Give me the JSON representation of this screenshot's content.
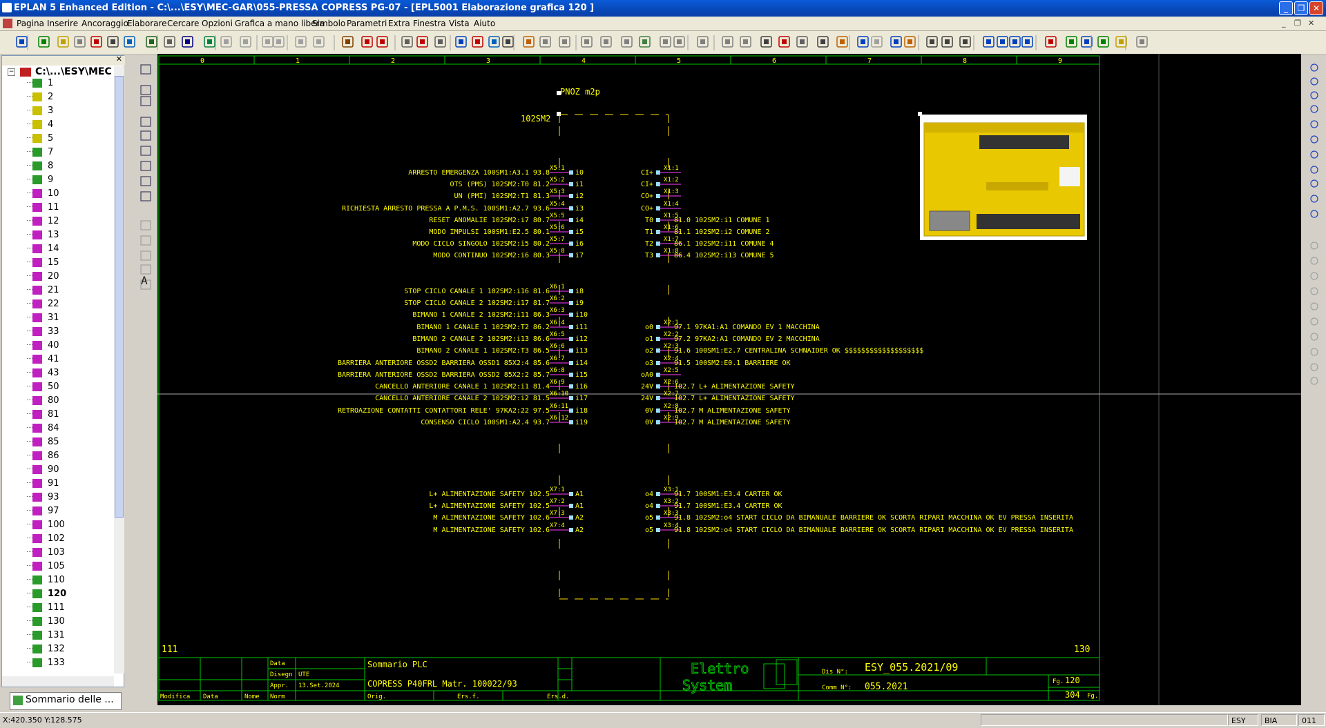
{
  "window": {
    "title": "EPLAN 5 Enhanced Edition - C:\\...\\ESY\\MEC-GAR\\055-PRESSA COPRESS PG-07 - [EPL5001 Elaborazione grafica 120    ]"
  },
  "menu": [
    "Pagina",
    "Inserire",
    "Ancoraggio",
    "Elaborare",
    "Cercare",
    "Opzioni",
    "Grafica a mano libera",
    "Simbolo",
    "Parametri",
    "Extra",
    "Finestra",
    "Vista",
    "Aiuto"
  ],
  "tree": {
    "root": "C:\\...\\ESY\\MEC",
    "pages": [
      {
        "label": "1",
        "type": "green"
      },
      {
        "label": "2",
        "type": "yellow"
      },
      {
        "label": "3",
        "type": "yellow"
      },
      {
        "label": "4",
        "type": "yellow"
      },
      {
        "label": "5",
        "type": "yellow"
      },
      {
        "label": "7",
        "type": "green"
      },
      {
        "label": "8",
        "type": "green"
      },
      {
        "label": "9",
        "type": "green"
      },
      {
        "label": "10",
        "type": "magenta"
      },
      {
        "label": "11",
        "type": "magenta"
      },
      {
        "label": "12",
        "type": "magenta"
      },
      {
        "label": "13",
        "type": "magenta"
      },
      {
        "label": "14",
        "type": "magenta"
      },
      {
        "label": "15",
        "type": "magenta"
      },
      {
        "label": "20",
        "type": "magenta"
      },
      {
        "label": "21",
        "type": "magenta"
      },
      {
        "label": "22",
        "type": "magenta"
      },
      {
        "label": "31",
        "type": "magenta"
      },
      {
        "label": "33",
        "type": "magenta"
      },
      {
        "label": "40",
        "type": "magenta"
      },
      {
        "label": "41",
        "type": "magenta"
      },
      {
        "label": "43",
        "type": "magenta"
      },
      {
        "label": "50",
        "type": "magenta"
      },
      {
        "label": "80",
        "type": "magenta"
      },
      {
        "label": "81",
        "type": "magenta"
      },
      {
        "label": "84",
        "type": "magenta"
      },
      {
        "label": "85",
        "type": "magenta"
      },
      {
        "label": "86",
        "type": "magenta"
      },
      {
        "label": "90",
        "type": "magenta"
      },
      {
        "label": "91",
        "type": "magenta"
      },
      {
        "label": "93",
        "type": "magenta"
      },
      {
        "label": "97",
        "type": "magenta"
      },
      {
        "label": "100",
        "type": "magenta"
      },
      {
        "label": "102",
        "type": "magenta"
      },
      {
        "label": "103",
        "type": "magenta"
      },
      {
        "label": "105",
        "type": "magenta"
      },
      {
        "label": "110",
        "type": "green"
      },
      {
        "label": "120",
        "type": "green",
        "selected": true
      },
      {
        "label": "111",
        "type": "green"
      },
      {
        "label": "130",
        "type": "green"
      },
      {
        "label": "131",
        "type": "green"
      },
      {
        "label": "132",
        "type": "green"
      },
      {
        "label": "133",
        "type": "green"
      }
    ],
    "tab_label": "Sommario delle ..."
  },
  "drawing": {
    "columns": [
      "0",
      "1",
      "2",
      "3",
      "4",
      "5",
      "6",
      "7",
      "8",
      "9"
    ],
    "device_name": "PNOZ m2p",
    "device_tag": "102SM2",
    "left_terminals": [
      {
        "label": "ARRESTO EMERGENZA 100SM1:A3.1 93.8",
        "term": "X5:1",
        "io": "i0"
      },
      {
        "label": "OTS (PMS) 102SM2:T0 81.2",
        "term": "X5:2",
        "io": "i1"
      },
      {
        "label": "UN (PMI) 102SM2:T1 81.3",
        "term": "X5:3",
        "io": "i2"
      },
      {
        "label": "RICHIESTA ARRESTO PRESSA A P.M.S. 100SM1:A2.7 93.6",
        "term": "X5:4",
        "io": "i3"
      },
      {
        "label": "RESET ANOMALIE 102SM2:i7 80.7",
        "term": "X5:5",
        "io": "i4"
      },
      {
        "label": "MODO IMPULSI 100SM1:E2.5 80.1",
        "term": "X5:6",
        "io": "i5"
      },
      {
        "label": "MODO CICLO SINGOLO 102SM2:i5 80.2",
        "term": "X5:7",
        "io": "i6"
      },
      {
        "label": "MODO CONTINUO 102SM2:i6 80.3",
        "term": "X5:8",
        "io": "i7"
      },
      {
        "label": "STOP CICLO CANALE 1 102SM2:i16 81.6",
        "term": "X6:1",
        "io": "i8"
      },
      {
        "label": "STOP CICLO CANALE 2 102SM2:i17 81.7",
        "term": "X6:2",
        "io": "i9"
      },
      {
        "label": "BIMANO 1 CANALE 2 102SM2:i11 86.3",
        "term": "X6:3",
        "io": "i10"
      },
      {
        "label": "BIMANO 1 CANALE 1 102SM2:T2 86.2",
        "term": "X6:4",
        "io": "i11"
      },
      {
        "label": "BIMANO 2 CANALE 2 102SM2:i13 86.6",
        "term": "X6:5",
        "io": "i12"
      },
      {
        "label": "BIMANO 2 CANALE 1 102SM2:T3 86.5",
        "term": "X6:6",
        "io": "i13"
      },
      {
        "label": "BARRIERA ANTERIORE OSSD2 BARRIERA OSSD1 85X2:4 85.6",
        "term": "X6:7",
        "io": "i14"
      },
      {
        "label": "BARRIERA ANTERIORE OSSD2 BARRIERA OSSD2 85X2:2 85.7",
        "term": "X6:8",
        "io": "i15"
      },
      {
        "label": "CANCELLO ANTERIORE CANALE 1 102SM2:i1 81.4",
        "term": "X6:9",
        "io": "i16"
      },
      {
        "label": "CANCELLO ANTERIORE CANALE 2 102SM2:i2 81.5",
        "term": "X6:10",
        "io": "i17"
      },
      {
        "label": "RETROAZIONE CONTATTI CONTATTORI RELE' 97KA2:22 97.5",
        "term": "X6:11",
        "io": "i18"
      },
      {
        "label": "CONSENSO CICLO 100SM1:A2.4 93.7",
        "term": "X6:12",
        "io": "i19"
      },
      {
        "label": "L+ ALIMENTAZIONE SAFETY 102.5",
        "term": "X7:1",
        "io": "A1"
      },
      {
        "label": "L+ ALIMENTAZIONE SAFETY 102.5",
        "term": "X7:2",
        "io": "A1"
      },
      {
        "label": "M ALIMENTAZIONE SAFETY 102.6",
        "term": "X7:3",
        "io": "A2"
      },
      {
        "label": "M ALIMENTAZIONE SAFETY 102.6",
        "term": "X7:4",
        "io": "A2"
      }
    ],
    "right_terminals": [
      {
        "io": "CI+",
        "term": "X1:1",
        "label": ""
      },
      {
        "io": "CI+",
        "term": "X1:2",
        "label": ""
      },
      {
        "io": "CO+",
        "term": "X1:3",
        "label": ""
      },
      {
        "io": "CO+",
        "term": "X1:4",
        "label": ""
      },
      {
        "io": "T0",
        "term": "X1:5",
        "label": "81.0 102SM2:i1 COMUNE 1"
      },
      {
        "io": "T1",
        "term": "X1:6",
        "label": "81.1 102SM2:i2 COMUNE 2"
      },
      {
        "io": "T2",
        "term": "X1:7",
        "label": "86.1 102SM2:i11 COMUNE 4"
      },
      {
        "io": "T3",
        "term": "X1:8",
        "label": "86.4 102SM2:i13 COMUNE 5"
      },
      {
        "io": "o0",
        "term": "X2:1",
        "label": "97.1 97KA1:A1 COMANDO EV 1 MACCHINA"
      },
      {
        "io": "o1",
        "term": "X2:2",
        "label": "97.2 97KA2:A1 COMANDO EV 2 MACCHINA"
      },
      {
        "io": "o2",
        "term": "X2:3",
        "label": "91.6 100SM1:E2.7 CENTRALINA SCHNAIDER OK $$$$$$$$$$$$$$$$$$$"
      },
      {
        "io": "o3",
        "term": "X2:4",
        "label": "91.5 100SM2:E0.1 BARRIERE OK"
      },
      {
        "io": "oA0",
        "term": "X2:5",
        "label": ""
      },
      {
        "io": "24V",
        "term": "X2:6",
        "label": "102.7  L+ ALIMENTAZIONE SAFETY"
      },
      {
        "io": "24V",
        "term": "X2:7",
        "label": "102.7  L+ ALIMENTAZIONE SAFETY"
      },
      {
        "io": "0V",
        "term": "X2:8",
        "label": "102.7  M ALIMENTAZIONE SAFETY"
      },
      {
        "io": "0V",
        "term": "X2:9",
        "label": "102.7  M ALIMENTAZIONE SAFETY"
      },
      {
        "io": "o4",
        "term": "X3:1",
        "label": "91.7 100SM1:E3.4 CARTER OK"
      },
      {
        "io": "o4",
        "term": "X3:2",
        "label": "91.7 100SM1:E3.4 CARTER OK"
      },
      {
        "io": "o5",
        "term": "X3:3",
        "label": "91.8 102SM2:o4 START CICLO DA BIMANUALE BARRIERE OK SCORTA RIPARI MACCHINA OK EV PRESSA INSERITA"
      },
      {
        "io": "o5",
        "term": "X3:4",
        "label": "91.8 102SM2:o4 START CICLO DA BIMANUALE BARRIERE OK SCORTA RIPARI MACCHINA OK EV PRESSA INSERITA"
      }
    ],
    "prev_page": "111",
    "next_page": "130",
    "titleblock": {
      "data_lbl": "Data",
      "disegn_lbl": "Disegn",
      "disegn_val": "UTE",
      "appr_lbl": "Appr.",
      "appr_val": "13.Set.2024",
      "modifica": "Modifica",
      "data2": "Data",
      "nome": "Nome",
      "norm": "Norm",
      "orig": "Orig.",
      "ers_f": "Ers.f.",
      "ers_d": "Ers.d.",
      "desc1": "Sommario PLC",
      "desc2": "COPRESS P40FRL Matr. 100022/93",
      "logo1": "Elettro",
      "logo2": "System",
      "dis_lbl": "Dis N°:",
      "dis_val": "ESY_055.2021/09",
      "comm_lbl": "Comm N°:",
      "comm_val": "055.2021",
      "fg_lbl": "Fg.",
      "fg_val": "120",
      "fgs_val": "304",
      "fgs_lbl": "Fg."
    }
  },
  "status": {
    "coords": "X:420.350 Y:128.575",
    "panel1": "ESY",
    "panel2": "BIA",
    "panel3": "011"
  },
  "colors": {
    "canvas_bg": "#000000",
    "frame": "#00c800",
    "text": "#ffff00",
    "terminal": "#ff40ff",
    "device": "#ffe000"
  }
}
